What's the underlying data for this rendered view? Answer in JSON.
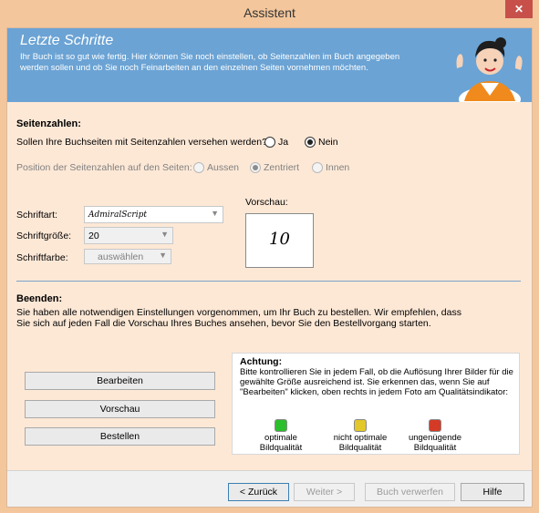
{
  "window": {
    "title": "Assistent",
    "close_label": "✕"
  },
  "header": {
    "title": "Letzte Schritte",
    "description": "Ihr Buch ist so gut wie fertig. Hier können Sie noch einstellen, ob Seitenzahlen im Buch angegeben werden sollen und ob Sie noch Feinarbeiten an den einzelnen Seiten vornehmen möchten."
  },
  "page_numbers": {
    "section_title": "Seitenzahlen:",
    "question": "Sollen Ihre Buchseiten mit Seitenzahlen versehen werden?",
    "yes_label": "Ja",
    "no_label": "Nein",
    "selected": "Nein",
    "position_label": "Position der Seitenzahlen auf den Seiten:",
    "positions": [
      "Aussen",
      "Zentriert",
      "Innen"
    ],
    "position_selected": "Zentriert",
    "font_label": "Schriftart:",
    "font_value": "AdmiralScript",
    "size_label": "Schriftgröße:",
    "size_value": "20",
    "color_label": "Schriftfarbe:",
    "color_value": "auswählen",
    "preview_label": "Vorschau:",
    "preview_value": "10"
  },
  "finish": {
    "section_title": "Beenden:",
    "text": "Sie haben alle notwendigen Einstellungen vorgenommen, um Ihr Buch zu bestellen. Wir empfehlen, dass Sie sich auf jeden Fall die Vorschau Ihres Buches ansehen, bevor Sie den Bestellvorgang starten.",
    "edit_button": "Bearbeiten",
    "preview_button": "Vorschau",
    "order_button": "Bestellen"
  },
  "notice": {
    "title": "Achtung:",
    "text": "Bitte kontrollieren Sie in jedem Fall, ob die Auflösung Ihrer Bilder für die gewählte Größe ausreichend ist. Sie erkennen das, wenn Sie auf \"Bearbeiten\" klicken, oben rechts in jedem Foto am Qualitätsindikator:",
    "indicators": [
      {
        "label": "optimale Bildqualität",
        "color": "#2bbf2b"
      },
      {
        "label": "nicht optimale Bildqualität",
        "color": "#e2c82a"
      },
      {
        "label": "ungenügende Bildqualität",
        "color": "#d53a27"
      }
    ]
  },
  "footer": {
    "back": "< Zurück",
    "next": "Weiter >",
    "discard": "Buch verwerfen",
    "help": "Hilfe"
  },
  "colors": {
    "window_background": "#f3c69c",
    "panel_background": "#fde8d6",
    "header_background": "#6ba3d4",
    "close_button": "#c7504b"
  }
}
